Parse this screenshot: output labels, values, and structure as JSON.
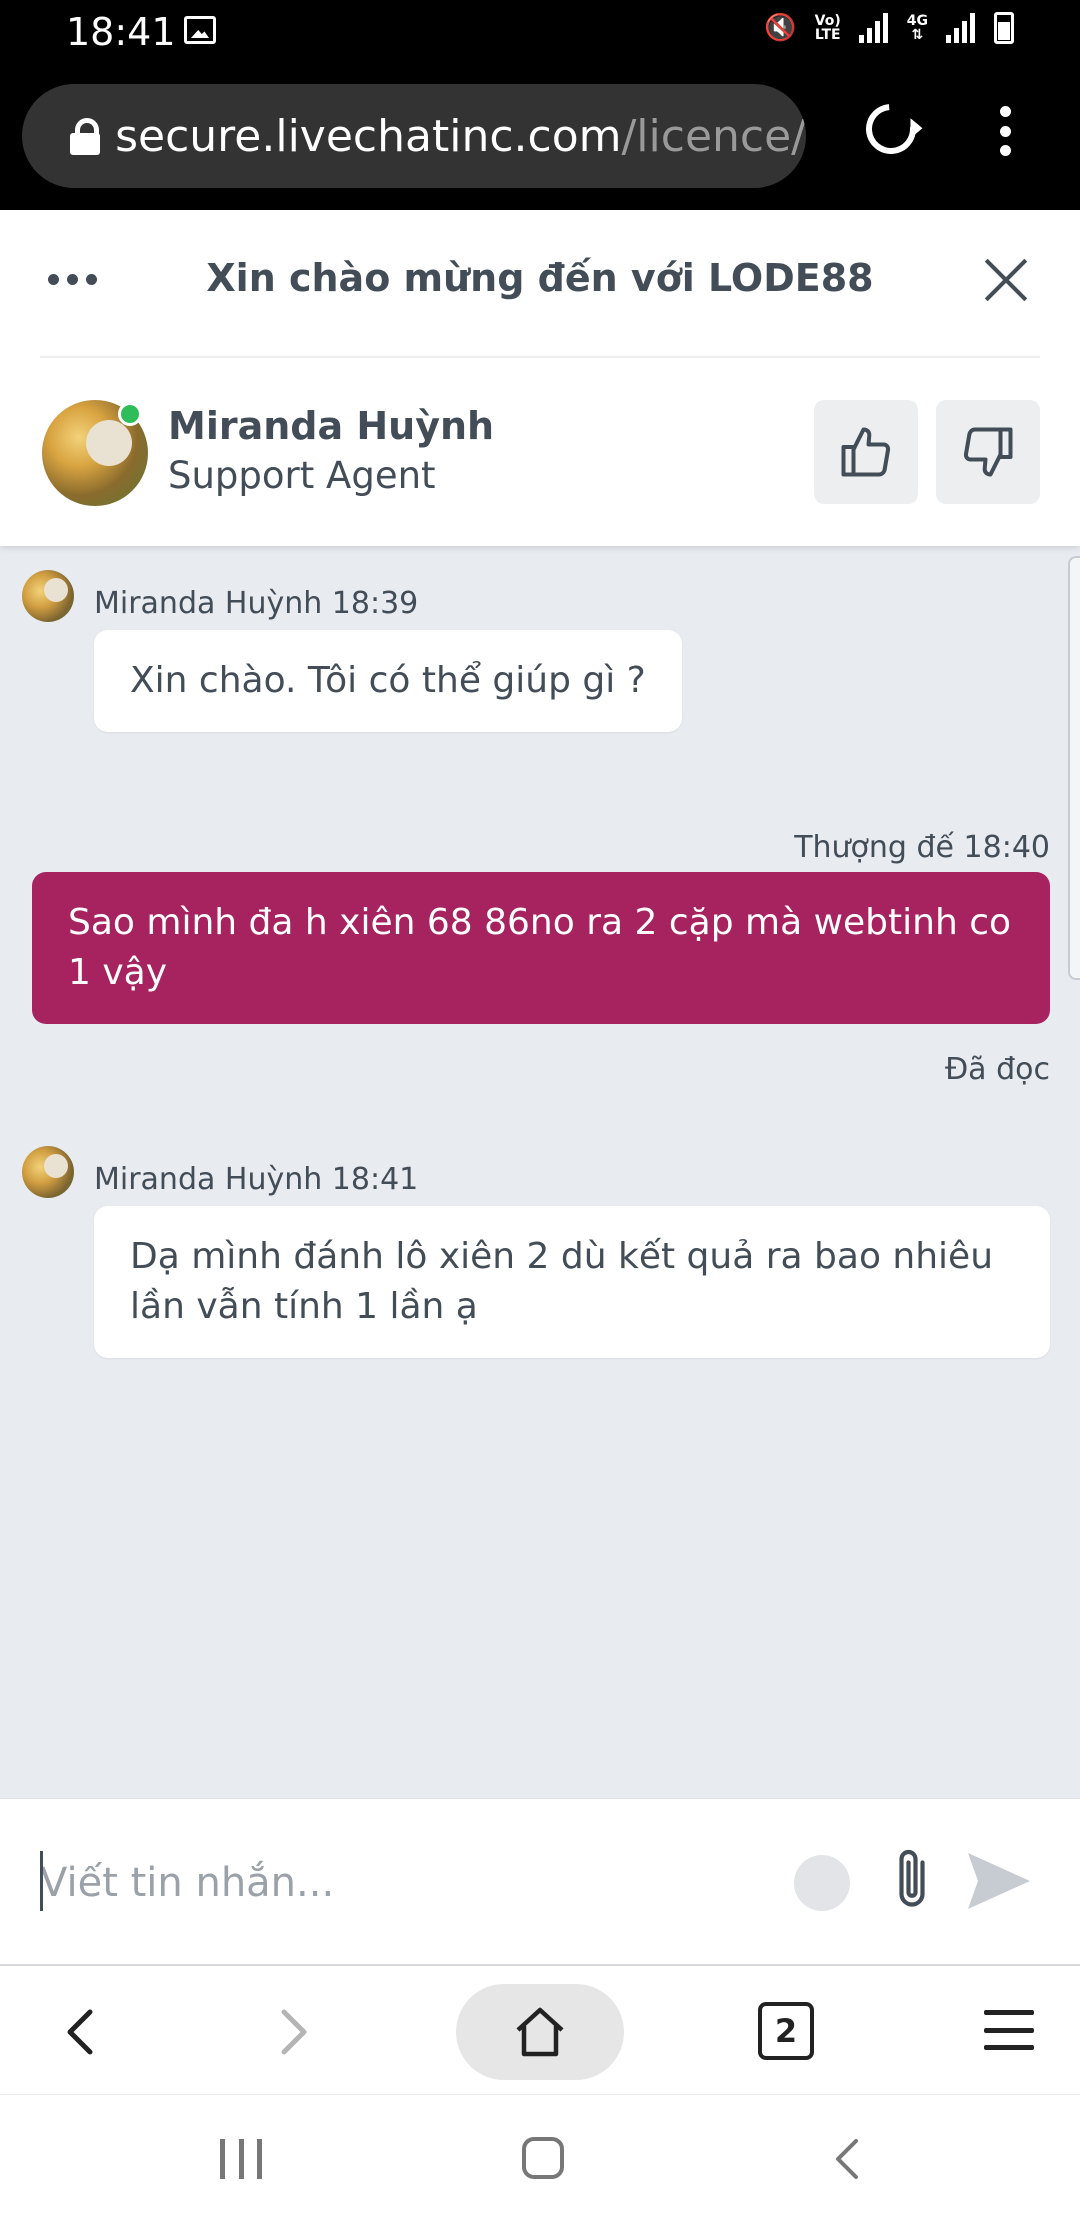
{
  "status_bar": {
    "time": "18:41",
    "icons": [
      "image-icon",
      "mute-icon",
      "volte-icon",
      "signal-icon",
      "4g-icon",
      "signal-icon",
      "battery-icon"
    ],
    "volte_label_top": "Vo)",
    "volte_label_bottom": "LTE",
    "net_label": "4G"
  },
  "browser": {
    "url_host": "secure.livechatinc.com",
    "url_path": "/licence/"
  },
  "chat": {
    "title": "Xin chào mừng đến với LODE88",
    "agent": {
      "name": "Miranda Huỳnh",
      "role": "Support Agent",
      "status": "online"
    },
    "messages": [
      {
        "sender": "Miranda Huỳnh",
        "time": "18:39",
        "meta": "Miranda Huỳnh 18:39",
        "text": "Xin chào. Tôi có thể giúp gì ?"
      },
      {
        "sender": "Thượng đế",
        "time": "18:40",
        "meta": "Thượng đế 18:40",
        "text": "Sao mình đa h xiên 68 86no ra 2 cặp mà webtinh co 1 vậy",
        "status": "Đã đọc"
      },
      {
        "sender": "Miranda Huỳnh",
        "time": "18:41",
        "meta": "Miranda Huỳnh 18:41",
        "text": "Dạ mình đánh lô xiên 2 dù kết quả ra bao nhiêu lần vẫn tính 1 lần ạ"
      }
    ],
    "composer": {
      "placeholder": "Viết tin nhắn...",
      "value": ""
    }
  },
  "browser_nav": {
    "tab_count": "2"
  },
  "colors": {
    "user_bubble": "#a62360",
    "chat_bg": "#e8ebf0",
    "text": "#424d57",
    "online": "#2ebd59"
  }
}
